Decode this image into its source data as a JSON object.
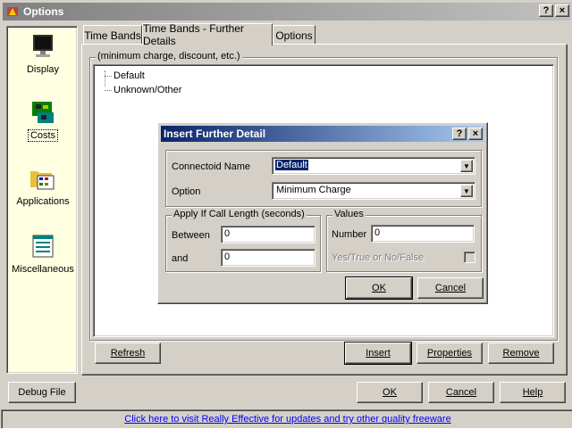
{
  "window": {
    "title": "Options",
    "help_button": "?",
    "close_button": "×"
  },
  "sidebar": {
    "items": [
      {
        "label": "Display",
        "icon": "monitor-icon"
      },
      {
        "label": "Costs",
        "icon": "circuit-board-icon"
      },
      {
        "label": "Applications",
        "icon": "folder-applications-icon"
      },
      {
        "label": "Miscellaneous",
        "icon": "document-list-icon"
      }
    ],
    "selected": "Costs"
  },
  "tabs": [
    {
      "label": "Time Bands"
    },
    {
      "label": "Time Bands - Further Details",
      "active": true
    },
    {
      "label": "Options"
    }
  ],
  "panel": {
    "group_title": "(minimum charge, discount, etc.)",
    "tree": [
      "Default",
      "Unknown/Other"
    ],
    "buttons": {
      "refresh": "Refresh",
      "insert": "Insert",
      "properties": "Properties",
      "remove": "Remove"
    }
  },
  "footer": {
    "debug_file": "Debug File",
    "ok": "OK",
    "cancel": "Cancel",
    "help": "Help",
    "link": "Click here to visit Really Effective for updates and try other quality freeware"
  },
  "dialog": {
    "title": "Insert Further Detail",
    "help_button": "?",
    "close_button": "×",
    "connectoid_label": "Connectoid Name",
    "connectoid_value": "Default",
    "option_label": "Option",
    "option_value": "Minimum Charge",
    "call_length": {
      "title": "Apply If Call Length (seconds)",
      "between_label": "Between",
      "between_value": "0",
      "and_label": "and",
      "and_value": "0"
    },
    "values": {
      "title": "Values",
      "number_label": "Number",
      "number_value": "0",
      "yes_no_label": "Yes/True or No/False",
      "yes_no_checked": false
    },
    "ok": "OK",
    "cancel": "Cancel"
  },
  "colors": {
    "face": "#d4d0c8",
    "dialog_title": "#0a246a",
    "sidebar_bg": "#ffffe1",
    "link": "#0000ff"
  }
}
